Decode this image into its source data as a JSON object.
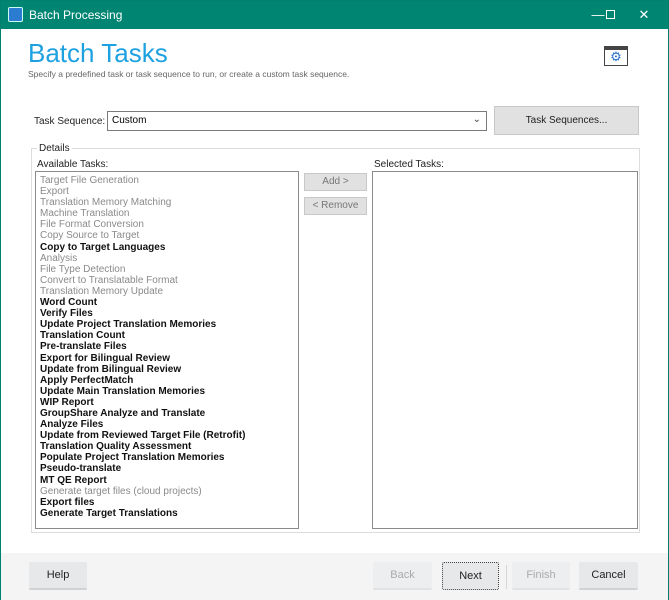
{
  "window": {
    "title": "Batch Processing",
    "controls": [
      "minimize",
      "maximize",
      "close"
    ]
  },
  "header": {
    "title": "Batch Tasks",
    "subtitle": "Specify a predefined task or task sequence to run, or create a custom task sequence.",
    "icon": "settings-window-icon"
  },
  "task_sequence": {
    "label": "Task Sequence:",
    "value": "Custom",
    "button": "Task Sequences..."
  },
  "details": {
    "legend": "Details",
    "available_label": "Available Tasks:",
    "selected_label": "Selected Tasks:",
    "add": "Add >",
    "remove": "< Remove",
    "available": [
      {
        "label": "Target File Generation",
        "enabled": false
      },
      {
        "label": "Export",
        "enabled": false
      },
      {
        "label": "Translation Memory Matching",
        "enabled": false
      },
      {
        "label": "Machine Translation",
        "enabled": false
      },
      {
        "label": "File Format Conversion",
        "enabled": false
      },
      {
        "label": "Copy Source to Target",
        "enabled": false
      },
      {
        "label": "Copy to Target Languages",
        "enabled": true
      },
      {
        "label": "Analysis",
        "enabled": false
      },
      {
        "label": "File Type Detection",
        "enabled": false
      },
      {
        "label": "Convert to Translatable Format",
        "enabled": false
      },
      {
        "label": "Translation Memory Update",
        "enabled": false
      },
      {
        "label": "Word Count",
        "enabled": true
      },
      {
        "label": "Verify Files",
        "enabled": true
      },
      {
        "label": "Update Project Translation Memories",
        "enabled": true
      },
      {
        "label": "Translation Count",
        "enabled": true
      },
      {
        "label": "Pre-translate Files",
        "enabled": true
      },
      {
        "label": "Export for Bilingual Review",
        "enabled": true
      },
      {
        "label": "Update from Bilingual Review",
        "enabled": true
      },
      {
        "label": "Apply PerfectMatch",
        "enabled": true
      },
      {
        "label": "Update Main Translation Memories",
        "enabled": true
      },
      {
        "label": "WIP Report",
        "enabled": true
      },
      {
        "label": "GroupShare Analyze and Translate",
        "enabled": true
      },
      {
        "label": "Analyze Files",
        "enabled": true
      },
      {
        "label": "Update from Reviewed Target File (Retrofit)",
        "enabled": true
      },
      {
        "label": "Translation Quality Assessment",
        "enabled": true
      },
      {
        "label": "Populate Project Translation Memories",
        "enabled": true
      },
      {
        "label": "Pseudo-translate",
        "enabled": true
      },
      {
        "label": "MT QE Report",
        "enabled": true
      },
      {
        "label": "Generate target files (cloud projects)",
        "enabled": false
      },
      {
        "label": "Export files",
        "enabled": true
      },
      {
        "label": "Generate Target Translations",
        "enabled": true
      }
    ],
    "selected": []
  },
  "footer": {
    "help": "Help",
    "back": "Back",
    "next": "Next",
    "finish": "Finish",
    "cancel": "Cancel"
  },
  "colors": {
    "titlebar": "#008573",
    "heading": "#1ea1e0"
  }
}
